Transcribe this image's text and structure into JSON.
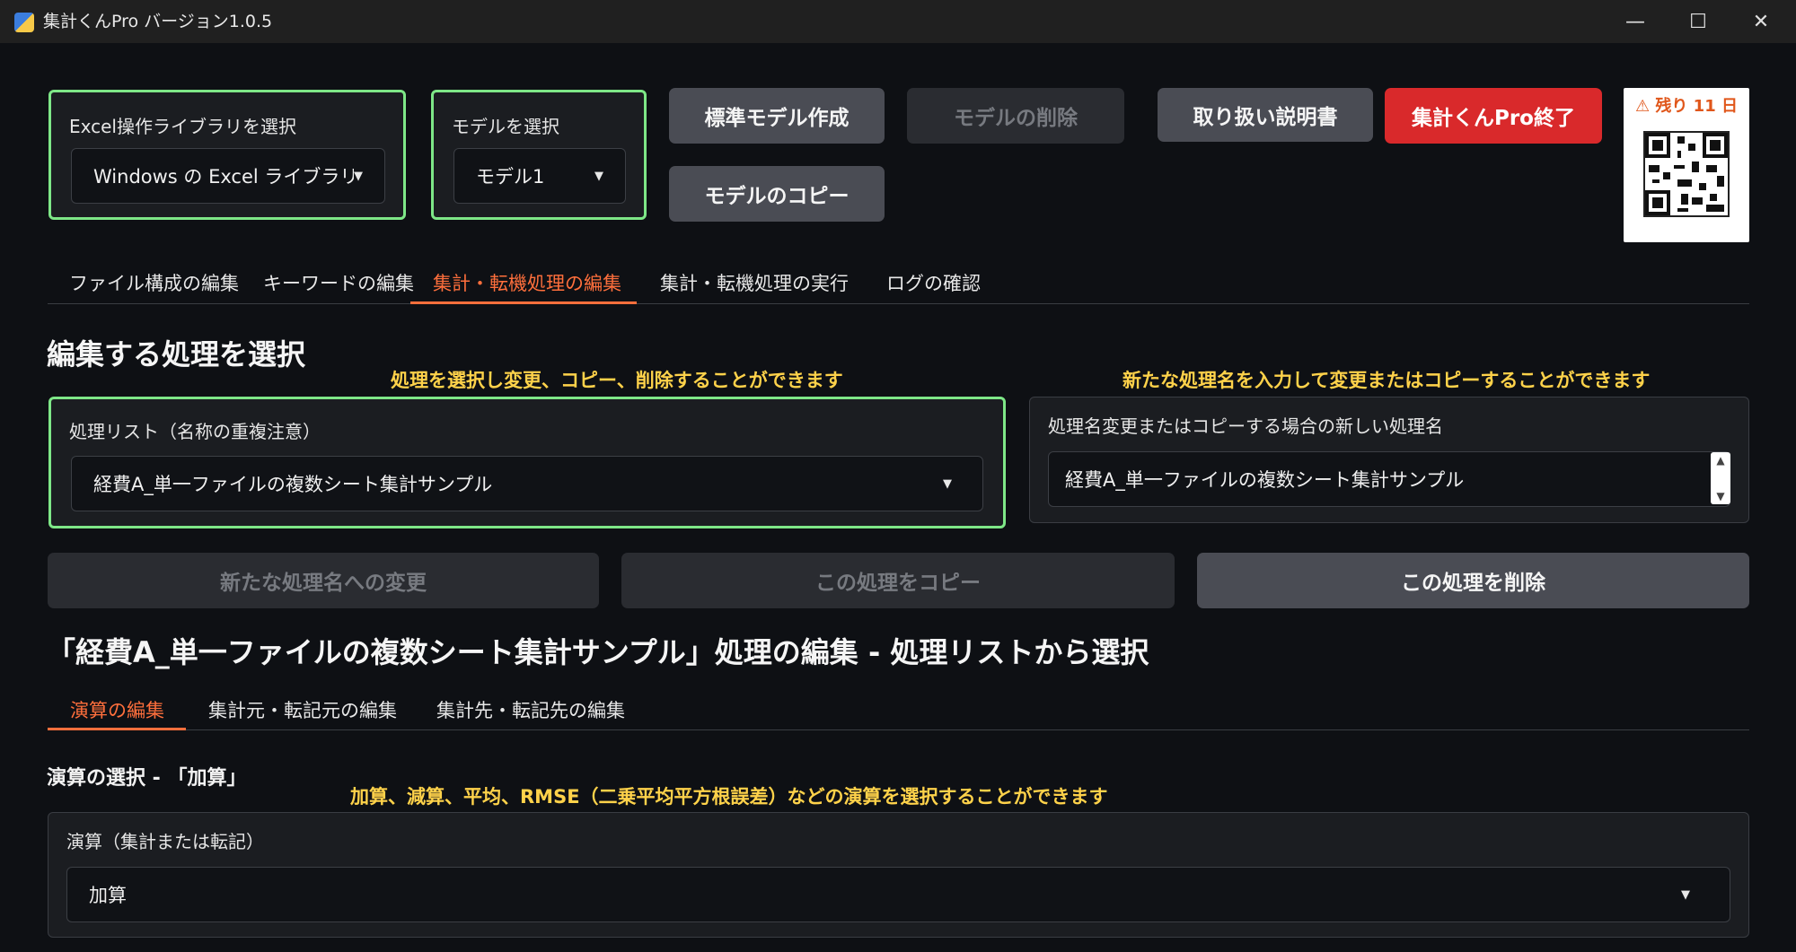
{
  "window": {
    "title": "集計くんPro バージョン1.0.5",
    "minimize": "—",
    "maximize": "☐",
    "close": "✕"
  },
  "excel_library": {
    "label": "Excel操作ライブラリを選択",
    "value": "Windows の Excel ライブラリ"
  },
  "model_select": {
    "label": "モデルを選択",
    "value": "モデル1"
  },
  "buttons": {
    "create_standard_model": "標準モデル作成",
    "delete_model": "モデルの削除",
    "copy_model": "モデルのコピー",
    "manual": "取り扱い説明書",
    "quit": "集計くんPro終了"
  },
  "license": {
    "warning_icon": "⚠",
    "remaining": "残り 11 日",
    "qr_icon": "qr-code-icon"
  },
  "main_tabs": [
    {
      "label": "ファイル構成の編集",
      "active": false
    },
    {
      "label": "キーワードの編集",
      "active": false
    },
    {
      "label": "集計・転機処理の編集",
      "active": true
    },
    {
      "label": "集計・転機処理の実行",
      "active": false
    },
    {
      "label": "ログの確認",
      "active": false
    }
  ],
  "section_select": {
    "heading": "編集する処理を選択",
    "hint_left": "処理を選択し変更、コピー、削除することができます",
    "hint_right": "新たな処理名を入力して変更またはコピーすることができます",
    "process_list_label": "処理リスト（名称の重複注意）",
    "process_list_value": "経費A_単一ファイルの複数シート集計サンプル",
    "new_name_label": "処理名変更またはコピーする場合の新しい処理名",
    "new_name_value": "経費A_単一ファイルの複数シート集計サンプル"
  },
  "action_buttons": {
    "rename": "新たな処理名への変更",
    "copy": "この処理をコピー",
    "delete": "この処理を削除"
  },
  "edit_section": {
    "heading": "「経費A_単一ファイルの複数シート集計サンプル」処理の編集 - 処理リストから選択",
    "sub_tabs": [
      {
        "label": "演算の編集",
        "active": true
      },
      {
        "label": "集計元・転記元の編集",
        "active": false
      },
      {
        "label": "集計先・転記先の編集",
        "active": false
      }
    ],
    "operation_heading": "演算の選択 - 「加算」",
    "operation_hint": "加算、減算、平均、RMSE（二乗平均平方根誤差）などの演算を選択することができます",
    "operation_label": "演算（集計または転記）",
    "operation_value": "加算"
  },
  "colors": {
    "accent": "#ff6f3c",
    "focus_border": "#7ee787",
    "hint": "#ffd24a",
    "danger": "#d9292b"
  }
}
